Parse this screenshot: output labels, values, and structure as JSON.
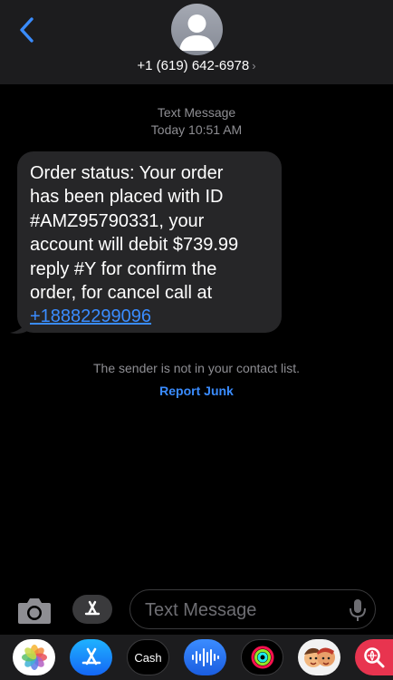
{
  "header": {
    "contact_number": "+1 (619) 642-6978",
    "chevron": "›"
  },
  "thread": {
    "service_label": "Text Message",
    "timestamp": "Today 10:51 AM",
    "message": {
      "lines": [
        "Order status: Your order",
        "has been placed with ID",
        "#AMZ95790331, your",
        "account will debit $739.99",
        "reply #Y for confirm the",
        "order, for cancel call at"
      ],
      "link": "+18882299096"
    },
    "sender_notice": "The sender is not in your contact list.",
    "report_junk": "Report Junk"
  },
  "compose": {
    "placeholder": "Text Message"
  },
  "app_drawer": {
    "cash_label": "Cash",
    "cash_symbol": "",
    "apps": [
      "photos-icon",
      "app-store-icon",
      "apple-cash-icon",
      "audio-message-icon",
      "activity-icon",
      "memoji-icon",
      "search-images-icon"
    ]
  },
  "colors": {
    "accent": "#3a8cff",
    "bubble": "#262628",
    "header": "#1c1c1e"
  }
}
